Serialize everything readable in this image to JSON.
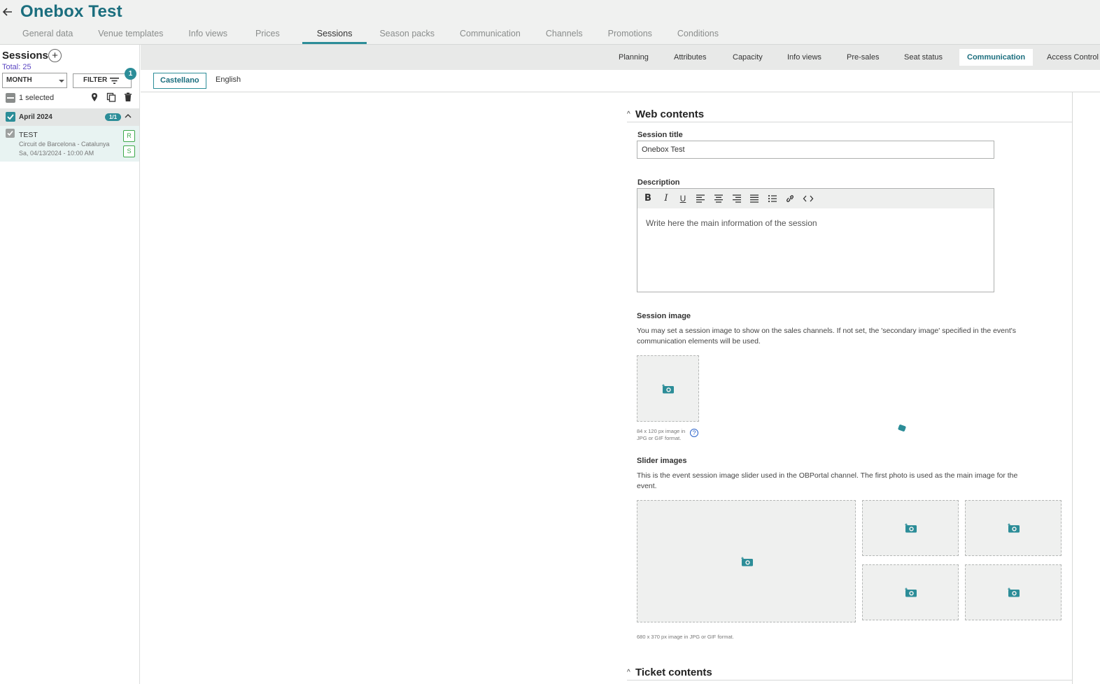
{
  "header": {
    "title": "Onebox Test",
    "tabs": [
      {
        "label": "General data",
        "active": false
      },
      {
        "label": "Venue templates",
        "active": false
      },
      {
        "label": "Info views",
        "active": false
      },
      {
        "label": "Prices",
        "active": false
      },
      {
        "label": "Sessions",
        "active": true
      },
      {
        "label": "Season packs",
        "active": false
      },
      {
        "label": "Communication",
        "active": false
      },
      {
        "label": "Channels",
        "active": false
      },
      {
        "label": "Promotions",
        "active": false
      },
      {
        "label": "Conditions",
        "active": false
      }
    ]
  },
  "sidebar": {
    "title": "Sessions",
    "add_label": "+",
    "total": "Total: 25",
    "period_select": "MONTH",
    "filter_label": "FILTER",
    "filter_count": "1",
    "selected_text": "1 selected",
    "month_group": {
      "label": "April 2024",
      "count": "1/1"
    },
    "session": {
      "name": "TEST",
      "venue": "Circuit de Barcelona - Catalunya",
      "date": "Sa, 04/13/2024 - 10:00 AM",
      "badges": [
        "R",
        "S"
      ]
    }
  },
  "subtabs": [
    {
      "label": "Planning",
      "active": false
    },
    {
      "label": "Attributes",
      "active": false
    },
    {
      "label": "Capacity",
      "active": false
    },
    {
      "label": "Info views",
      "active": false
    },
    {
      "label": "Pre-sales",
      "active": false
    },
    {
      "label": "Seat status",
      "active": false
    },
    {
      "label": "Communication",
      "active": true
    },
    {
      "label": "Access Control",
      "active": false
    }
  ],
  "languages": [
    {
      "label": "Castellano",
      "active": true
    },
    {
      "label": "English",
      "active": false
    }
  ],
  "web_contents": {
    "title": "Web contents",
    "session_title_label": "Session title",
    "session_title_value": "Onebox Test",
    "description_label": "Description",
    "description_placeholder": "Write here the main information of the session",
    "toolbar": [
      "bold",
      "italic",
      "underline",
      "align-left",
      "align-center",
      "align-right",
      "justify",
      "bullet-list",
      "link",
      "code"
    ],
    "session_image_label": "Session image",
    "session_image_help": "You may set a session image to show on the sales channels. If not set, the 'secondary image' specified in the event's communication elements will be used.",
    "session_image_hint": "84 x 120 px image in JPG or GIF format.",
    "slider_label": "Slider images",
    "slider_help": "This is the event session image slider used in the OBPortal channel. The first photo is used as the main image for the event.",
    "slider_hint": "680 x 370 px image in JPG or GIF format."
  },
  "ticket_contents": {
    "title": "Ticket contents"
  },
  "colors": {
    "brand": "#1b6e7e",
    "accent": "#2c8d98",
    "total": "#5b46c2",
    "badge_green": "#3ca84a"
  }
}
